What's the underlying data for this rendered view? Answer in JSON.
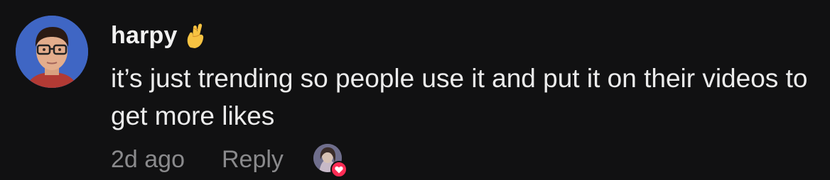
{
  "comment": {
    "username": "harpy",
    "username_emoji": "crossed-fingers-emoji",
    "text": "it’s just trending so people use it and put it on their videos to get more likes",
    "timestamp": "2d ago",
    "reply_label": "Reply",
    "creator_liked": true
  },
  "colors": {
    "background": "#111112",
    "muted_text": "#8a8a8c",
    "heart_badge": "#fe2c55"
  }
}
